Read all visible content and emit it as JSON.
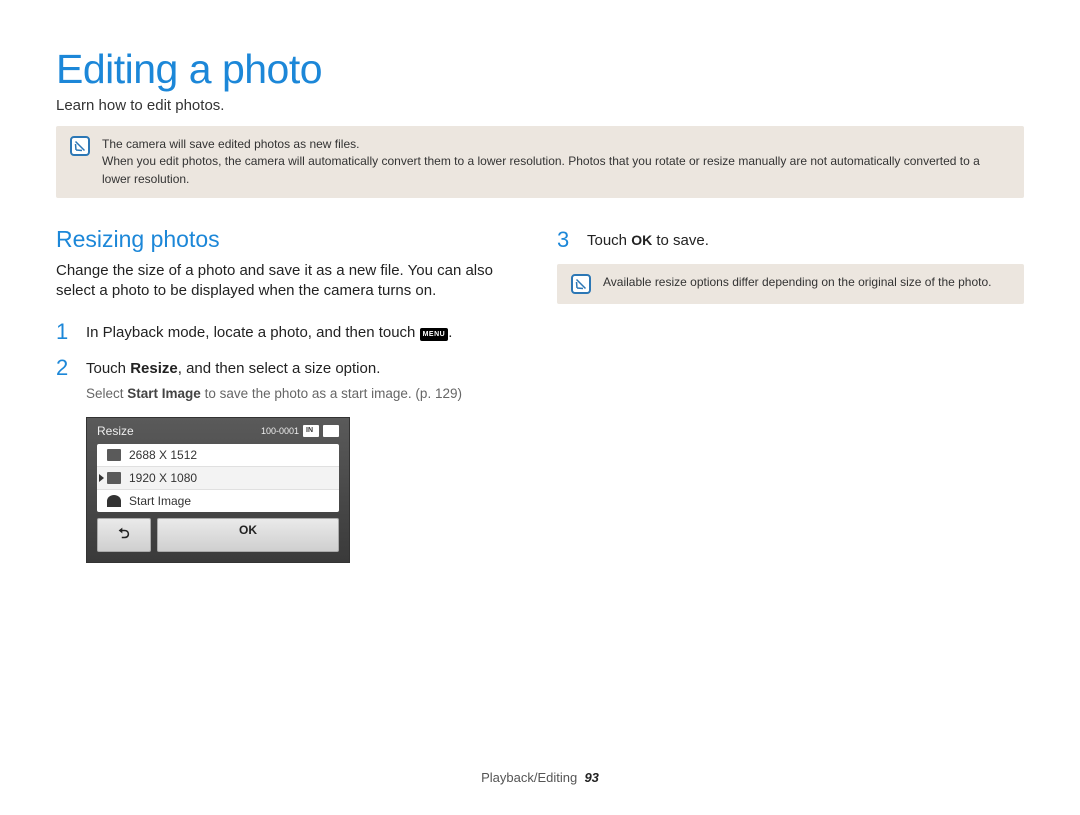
{
  "header": {
    "title": "Editing a photo",
    "subtitle": "Learn how to edit photos."
  },
  "top_note": {
    "line1": "The camera will save edited photos as new files.",
    "line2": "When you edit photos, the camera will automatically convert them to a lower resolution. Photos that you rotate or resize manually are not automatically converted to a lower resolution."
  },
  "left": {
    "heading": "Resizing photos",
    "desc": "Change the size of a photo and save it as a new file. You can also select a photo to be displayed when the camera turns on.",
    "step1_prefix": "In Playback mode, locate a photo, and then touch ",
    "step1_suffix": ".",
    "step2_prefix": "Touch ",
    "step2_bold": "Resize",
    "step2_suffix": ", and then select a size option.",
    "step2_sub_prefix": "Select ",
    "step2_sub_bold": "Start Image",
    "step2_sub_suffix": " to save the photo as a start image. (p. 129)"
  },
  "screen": {
    "title": "Resize",
    "file_no": "100-0001",
    "options": [
      {
        "label": "2688 X 1512",
        "selected": false
      },
      {
        "label": "1920 X 1080",
        "selected": true
      },
      {
        "label": "Start Image",
        "selected": false
      }
    ],
    "ok_label": "OK"
  },
  "right": {
    "step3_prefix": "Touch ",
    "step3_ok": "OK",
    "step3_suffix": " to save.",
    "note": "Available resize options differ depending on the original size of the photo."
  },
  "footer": {
    "section": "Playback/Editing",
    "page": "93"
  }
}
